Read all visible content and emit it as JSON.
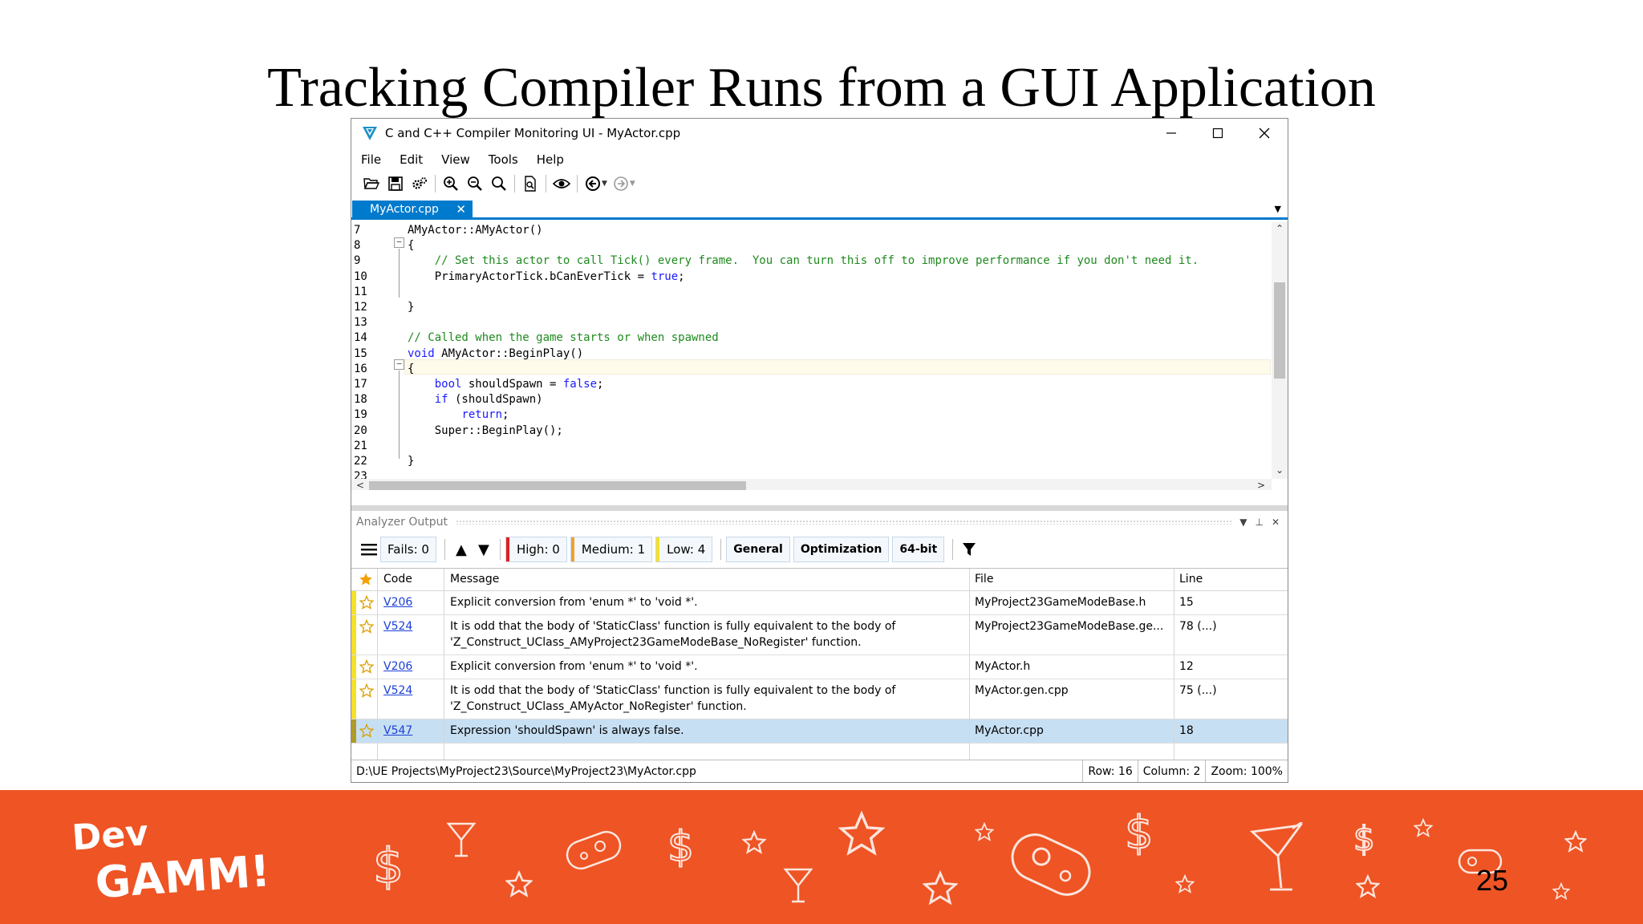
{
  "slide": {
    "title": "Tracking Compiler Runs from a GUI Application",
    "page_number": "25",
    "brand_line1": "Dev",
    "brand_line2": "GAMM!"
  },
  "window": {
    "title": "C and C++ Compiler Monitoring UI - MyActor.cpp",
    "menu": [
      "File",
      "Edit",
      "View",
      "Tools",
      "Help"
    ],
    "active_tab": "MyActor.cpp"
  },
  "editor": {
    "lines": [
      {
        "n": "7",
        "code": "AMyActor::AMyActor()"
      },
      {
        "n": "8",
        "code": "{"
      },
      {
        "n": "9",
        "code": "    // Set this actor to call Tick() every frame.  You can turn this off to improve performance if you don't need it."
      },
      {
        "n": "10",
        "code": "    PrimaryActorTick.bCanEverTick = true;"
      },
      {
        "n": "11",
        "code": ""
      },
      {
        "n": "12",
        "code": "}"
      },
      {
        "n": "13",
        "code": ""
      },
      {
        "n": "14",
        "code": "// Called when the game starts or when spawned"
      },
      {
        "n": "15",
        "code": "void AMyActor::BeginPlay()"
      },
      {
        "n": "16",
        "code": "{"
      },
      {
        "n": "17",
        "code": "    bool shouldSpawn = false;"
      },
      {
        "n": "18",
        "code": "    if (shouldSpawn)"
      },
      {
        "n": "19",
        "code": "        return;"
      },
      {
        "n": "20",
        "code": "    Super::BeginPlay();"
      },
      {
        "n": "21",
        "code": ""
      },
      {
        "n": "22",
        "code": "}"
      },
      {
        "n": "23",
        "code": ""
      }
    ]
  },
  "analyzer": {
    "panel_title": "Analyzer Output",
    "fails": "Fails: 0",
    "high": "High: 0",
    "medium": "Medium: 1",
    "low": "Low: 4",
    "filters": [
      "General",
      "Optimization",
      "64-bit"
    ],
    "columns": {
      "code": "Code",
      "message": "Message",
      "file": "File",
      "line": "Line"
    },
    "rows": [
      {
        "code": "V206",
        "message": "Explicit conversion from 'enum *' to 'void *'.",
        "message2": "",
        "file": "MyProject23GameModeBase.h",
        "line": "15"
      },
      {
        "code": "V524",
        "message": "It is odd that the body of 'StaticClass' function is fully equivalent to the body of",
        "message2": "'Z_Construct_UClass_AMyProject23GameModeBase_NoRegister' function.",
        "file": "MyProject23GameModeBase.ge...",
        "line": "78 (...)"
      },
      {
        "code": "V206",
        "message": "Explicit conversion from 'enum *' to 'void *'.",
        "message2": "",
        "file": "MyActor.h",
        "line": "12"
      },
      {
        "code": "V524",
        "message": "It is odd that the body of 'StaticClass' function is fully equivalent to the body of",
        "message2": "'Z_Construct_UClass_AMyActor_NoRegister' function.",
        "file": "MyActor.gen.cpp",
        "line": "75 (...)"
      },
      {
        "code": "V547",
        "message": "Expression 'shouldSpawn' is always false.",
        "message2": "",
        "file": "MyActor.cpp",
        "line": "18"
      }
    ]
  },
  "status": {
    "path": "D:\\UE Projects\\MyProject23\\Source\\MyProject23\\MyActor.cpp",
    "row": "Row: 16",
    "column": "Column: 2",
    "zoom": "Zoom: 100%"
  },
  "colors": {
    "accent": "#007acc",
    "banner": "#ee5424",
    "high": "#e02020",
    "medium": "#f0a030",
    "low": "#f5e02a",
    "keyword": "#1a1aff",
    "comment": "#1e8a1e",
    "literal": "#a31515"
  }
}
